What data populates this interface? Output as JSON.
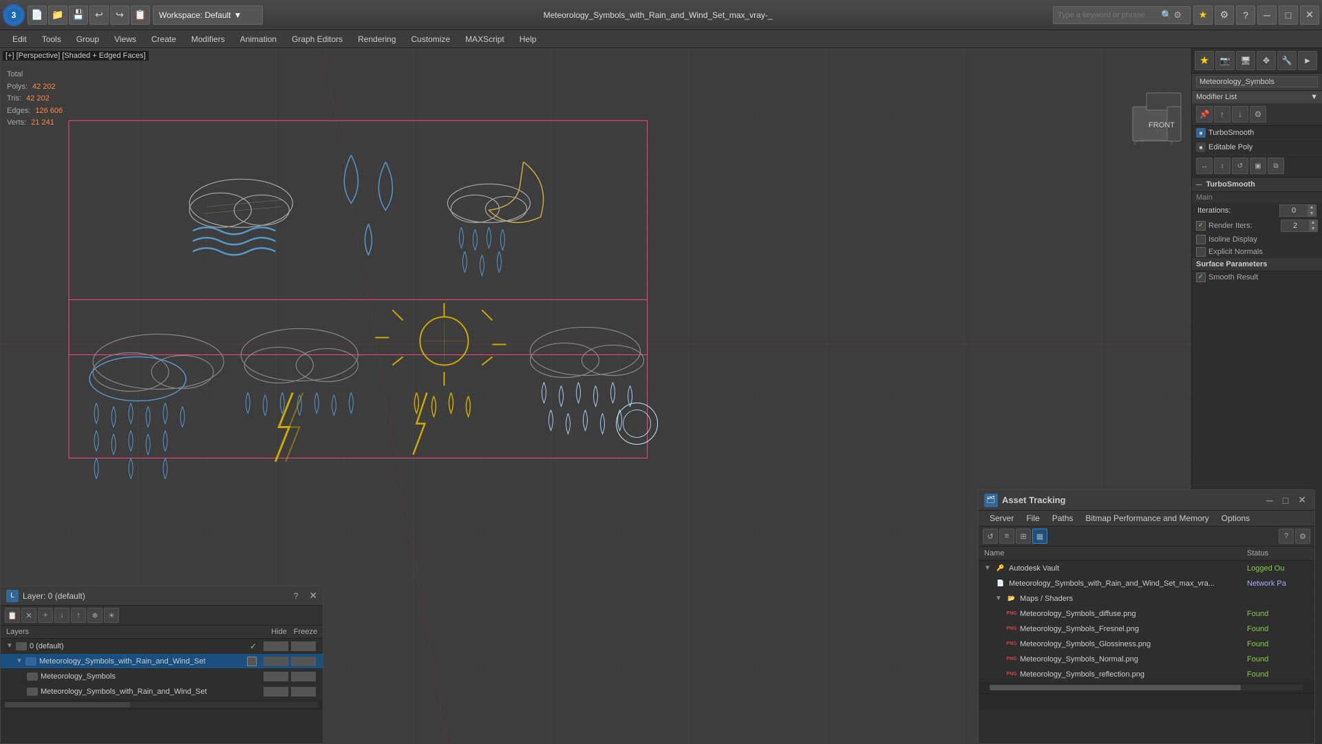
{
  "app": {
    "logo": "3",
    "title": "Meteorology_Symbols_with_Rain_and_Wind_Set_max_vray-_",
    "workspace": "Workspace: Default"
  },
  "search": {
    "placeholder": "Type a keyword or phrase"
  },
  "toolbar": {
    "buttons": [
      "📁",
      "💾",
      "↩",
      "↪",
      "📋"
    ]
  },
  "menu": {
    "items": [
      "Edit",
      "Tools",
      "Group",
      "Views",
      "Create",
      "Modifiers",
      "Animation",
      "Graph Editors",
      "Rendering",
      "Customize",
      "MAXScript",
      "Help"
    ]
  },
  "viewport": {
    "label": "[+] [Perspective] [Shaded + Edged Faces]"
  },
  "stats": {
    "polys_label": "Polys:",
    "polys_value": "42 202",
    "tris_label": "Tris:",
    "tris_value": "42 202",
    "edges_label": "Edges:",
    "edges_value": "126 606",
    "verts_label": "Verts:",
    "verts_value": "21 241",
    "total_label": "Total"
  },
  "right_panel": {
    "title": "Meteorology_Symbols",
    "modifier_list_label": "Modifier List",
    "modifiers": [
      {
        "name": "TurboSmooth",
        "type": "blue"
      },
      {
        "name": "Editable Poly",
        "type": "dark"
      }
    ],
    "turbosmooth": {
      "section": "TurboSmooth",
      "main_label": "Main",
      "iterations_label": "Iterations:",
      "iterations_value": "0",
      "render_iters_label": "Render Iters:",
      "render_iters_value": "2",
      "isoline_display": "Isoline Display",
      "explicit_normals": "Explicit Normals",
      "surface_params": "Surface Parameters",
      "smooth_result": "Smooth Result"
    }
  },
  "layer_panel": {
    "title": "Layer: 0 (default)",
    "layers_label": "Layers",
    "hide_label": "Hide",
    "freeze_label": "Freeze",
    "layers": [
      {
        "name": "0 (default)",
        "indent": 0,
        "expanded": true,
        "checked": true
      },
      {
        "name": "Meteorology_Symbols_with_Rain_and_Wind_Set",
        "indent": 1,
        "expanded": true,
        "selected": true
      },
      {
        "name": "Meteorology_Symbols",
        "indent": 2,
        "expanded": false
      },
      {
        "name": "Meteorology_Symbols_with_Rain_and_Wind_Set",
        "indent": 2,
        "expanded": false
      }
    ]
  },
  "asset_panel": {
    "title": "Asset Tracking",
    "menu": [
      "Server",
      "File",
      "Paths",
      "Bitmap Performance and Memory",
      "Options"
    ],
    "columns": {
      "name": "Name",
      "status": "Status"
    },
    "assets": [
      {
        "name": "Autodesk Vault",
        "type": "vault",
        "indent": 0,
        "status": "Logged Ou",
        "status_type": "logged"
      },
      {
        "name": "Meteorology_Symbols_with_Rain_and_Wind_Set_max_vra...",
        "type": "scene",
        "indent": 1,
        "status": "Network Pa",
        "status_type": "network"
      },
      {
        "name": "Maps / Shaders",
        "type": "folder",
        "indent": 1,
        "status": "",
        "status_type": ""
      },
      {
        "name": "Meteorology_Symbols_diffuse.png",
        "type": "png",
        "indent": 2,
        "status": "Found",
        "status_type": "found"
      },
      {
        "name": "Meteorology_Symbols_Fresnel.png",
        "type": "png",
        "indent": 2,
        "status": "Found",
        "status_type": "found"
      },
      {
        "name": "Meteorology_Symbols_Glossiness.png",
        "type": "png",
        "indent": 2,
        "status": "Found",
        "status_type": "found"
      },
      {
        "name": "Meteorology_Symbols_Normal.png",
        "type": "png",
        "indent": 2,
        "status": "Found",
        "status_type": "found"
      },
      {
        "name": "Meteorology_Symbols_reflection.png",
        "type": "png",
        "indent": 2,
        "status": "Found",
        "status_type": "found"
      }
    ]
  }
}
